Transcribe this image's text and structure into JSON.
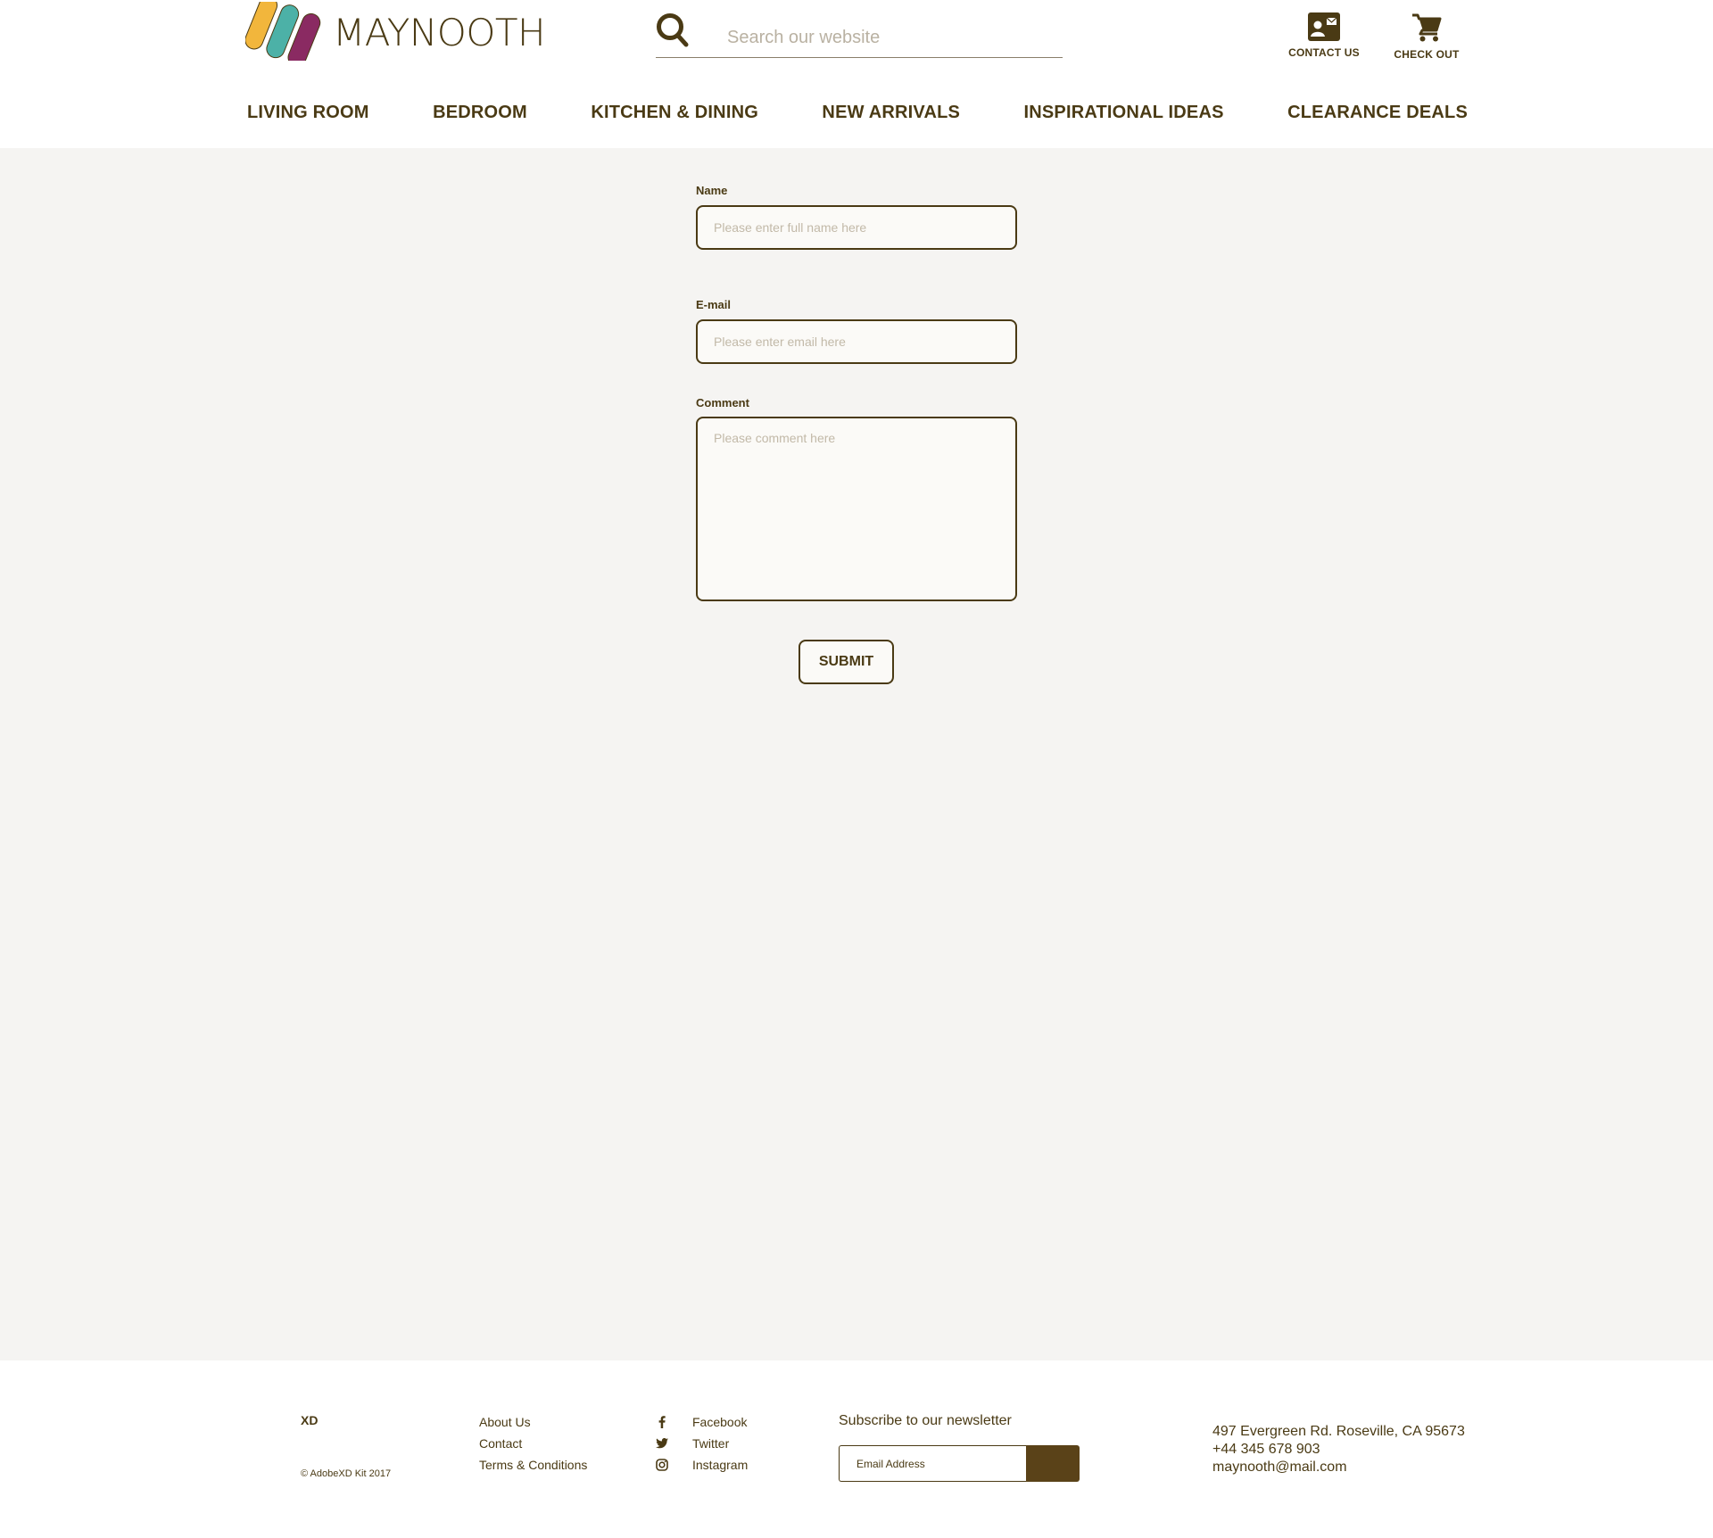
{
  "brand": {
    "name": "MAYNOOTH",
    "logo_colors": [
      "#f2b63c",
      "#4cb1a7",
      "#8a2a62"
    ]
  },
  "search": {
    "placeholder": "Search our website",
    "icon": "search-icon"
  },
  "header_actions": [
    {
      "label": "CONTACT  US",
      "icon": "contact-card-icon"
    },
    {
      "label": "CHECK OUT",
      "icon": "cart-icon"
    }
  ],
  "nav": {
    "items": [
      {
        "label": "LIVING ROOM"
      },
      {
        "label": "BEDROOM"
      },
      {
        "label": "KITCHEN & DINING"
      },
      {
        "label": "NEW ARRIVALS"
      },
      {
        "label": "INSPIRATIONAL IDEAS"
      },
      {
        "label": "CLEARANCE DEALS"
      }
    ]
  },
  "form": {
    "name": {
      "label": "Name",
      "placeholder": "Please enter full name here",
      "value": ""
    },
    "email": {
      "label": "E-mail",
      "placeholder": "Please enter email here",
      "value": ""
    },
    "comment": {
      "label": "Comment",
      "placeholder": "Please comment here",
      "value": ""
    },
    "submit_label": "SUBMIT"
  },
  "footer": {
    "brand": "XD",
    "copyright": "© AdobeXD Kit 2017",
    "links": [
      {
        "label": "About Us"
      },
      {
        "label": "Contact"
      },
      {
        "label": "Terms & Conditions"
      }
    ],
    "social": [
      {
        "label": "Facebook",
        "icon": "facebook-icon"
      },
      {
        "label": "Twitter",
        "icon": "twitter-icon"
      },
      {
        "label": "Instagram",
        "icon": "instagram-icon"
      }
    ],
    "newsletter": {
      "title": "Subscribe to our newsletter",
      "placeholder": "Email Address"
    },
    "address": {
      "street": "497 Evergreen Rd. Roseville, CA 95673",
      "phone": "+44 345 678 903",
      "email": "maynooth@mail.com"
    }
  },
  "colors": {
    "primary": "#4a3a14",
    "page_bg": "#f5f4f2",
    "header_bg": "#ffffff",
    "button_dark": "#5a4218"
  }
}
